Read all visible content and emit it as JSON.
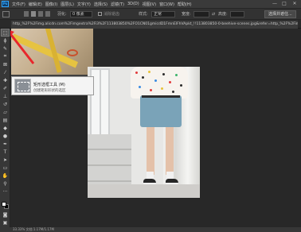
{
  "menubar": {
    "logo": "Ps",
    "items": [
      "文件(F)",
      "编辑(E)",
      "图像(I)",
      "图层(L)",
      "文字(Y)",
      "选择(S)",
      "滤镜(T)",
      "3D(D)",
      "视图(V)",
      "窗口(W)",
      "帮助(H)"
    ],
    "minimize": "—",
    "maximize": "□",
    "close": "✕"
  },
  "options": {
    "feather_label": "羽化:",
    "feather_value": "0 像素",
    "antialias_label": "消除锯齿",
    "style_label": "样式:",
    "style_value": "正常",
    "width_label": "宽度:",
    "height_label": "高度:",
    "select_mask_button": "选择并遮住..."
  },
  "document": {
    "tab_title": "http_%2F%2Fimg.alicdn.com%2Fimgextra%2Fi3%2F113803850%2FO1CN01gmicdD1FmnElFhVApkt_!!113803850-0-beehive-scenes.jpg&refer=http_%2F%2Fimg.alicdn..."
  },
  "tooltip": {
    "title": "矩形选框工具 (M)",
    "description": "创建矩形形状的选区"
  },
  "toolbar": {
    "tools": [
      {
        "name": "marquee-tool",
        "glyph": "⬚",
        "active": true
      },
      {
        "name": "lasso-tool",
        "glyph": "ϕ",
        "active": false
      },
      {
        "name": "quick-select-tool",
        "glyph": "✎",
        "active": false
      },
      {
        "name": "crop-tool",
        "glyph": "⌗",
        "active": false
      },
      {
        "name": "frame-tool",
        "glyph": "⊠",
        "active": false
      },
      {
        "name": "eyedropper-tool",
        "glyph": "⁄",
        "active": false
      },
      {
        "name": "healing-tool",
        "glyph": "✚",
        "active": false
      },
      {
        "name": "brush-tool",
        "glyph": "✐",
        "active": false
      },
      {
        "name": "stamp-tool",
        "glyph": "⊥",
        "active": false
      },
      {
        "name": "history-brush-tool",
        "glyph": "↺",
        "active": false
      },
      {
        "name": "eraser-tool",
        "glyph": "▱",
        "active": false
      },
      {
        "name": "gradient-tool",
        "glyph": "▤",
        "active": false
      },
      {
        "name": "blur-tool",
        "glyph": "◆",
        "active": false
      },
      {
        "name": "dodge-tool",
        "glyph": "●",
        "active": false
      },
      {
        "name": "pen-tool",
        "glyph": "✒",
        "active": false
      },
      {
        "name": "type-tool",
        "glyph": "T",
        "active": false
      },
      {
        "name": "path-select-tool",
        "glyph": "➤",
        "active": false
      },
      {
        "name": "shape-tool",
        "glyph": "▭",
        "active": false
      },
      {
        "name": "hand-tool",
        "glyph": "✋",
        "active": false
      },
      {
        "name": "zoom-tool",
        "glyph": "⚲",
        "active": false
      },
      {
        "name": "edit-toolbar",
        "glyph": "···",
        "active": false
      }
    ],
    "quick_mask_glyph": "◙",
    "screen_mode_glyph": "▣"
  },
  "status": {
    "text": "33.33%    文档:1.17M/1.17M"
  },
  "colors": {
    "accent": "#31a8ff",
    "arrow": "#e8262b",
    "foreground": "#ffffff",
    "background": "#000000"
  }
}
